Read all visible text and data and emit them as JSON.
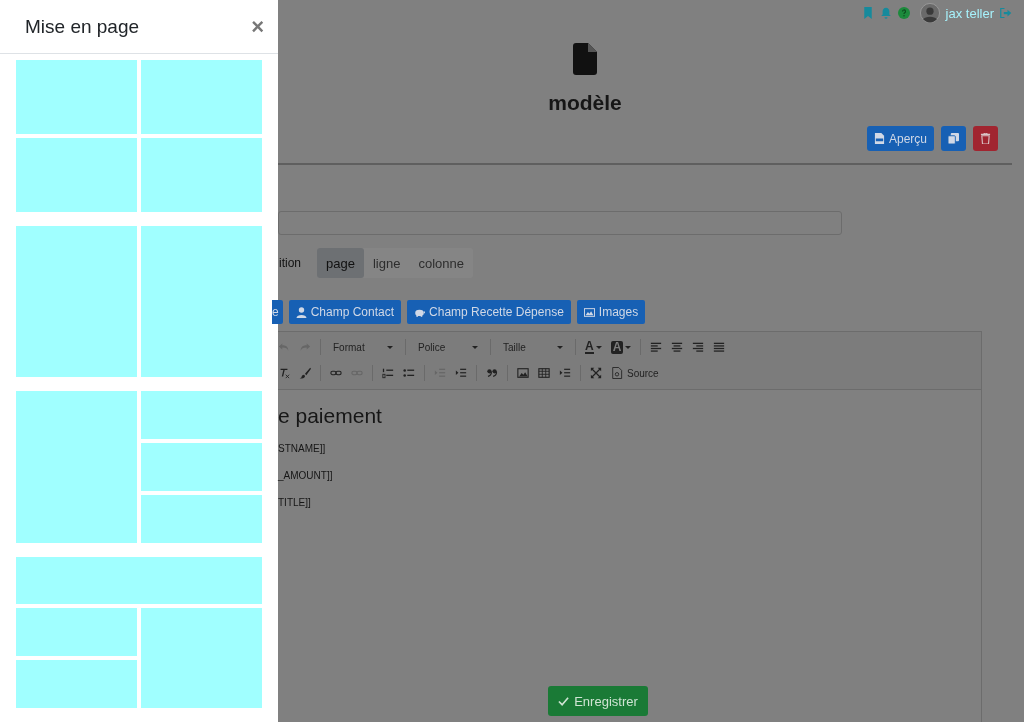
{
  "drawer": {
    "title": "Mise en page",
    "close": "×",
    "layouts": [
      {
        "kind": "grid-2x2"
      },
      {
        "kind": "two-columns"
      },
      {
        "kind": "left-tall-right-three"
      },
      {
        "kind": "header-left-two-right-tall"
      }
    ]
  },
  "header": {
    "user": "jax teller"
  },
  "page": {
    "title": "modèle",
    "actions": [
      {
        "kind": "preview",
        "label": "Aperçu",
        "color": "#1760b4"
      },
      {
        "kind": "copy",
        "color": "#1760b4"
      },
      {
        "kind": "delete",
        "color": "#a12530"
      }
    ],
    "position_label": "ition",
    "position_options": [
      {
        "label": "page",
        "selected": true
      },
      {
        "label": "ligne",
        "selected": false
      },
      {
        "label": "colonne",
        "selected": false
      }
    ],
    "field_buttons": [
      {
        "kind": "none",
        "label": "e"
      },
      {
        "kind": "person",
        "label": "Champ Contact"
      },
      {
        "kind": "piggy",
        "label": "Champ Recette Dépense"
      },
      {
        "kind": "image",
        "label": "Images"
      }
    ],
    "toolbar_rows": [
      [
        {
          "kind": "undo"
        },
        {
          "kind": "redo"
        },
        {
          "kind": "sep"
        },
        {
          "kind": "dropdown",
          "label": "Format"
        },
        {
          "kind": "sep"
        },
        {
          "kind": "dropdown",
          "label": "Police"
        },
        {
          "kind": "sep"
        },
        {
          "kind": "dropdown",
          "label": "Taille"
        },
        {
          "kind": "sep"
        },
        {
          "kind": "color",
          "label": "A"
        },
        {
          "kind": "bgcolor",
          "label": "A"
        },
        {
          "kind": "sep"
        },
        {
          "kind": "align-left"
        },
        {
          "kind": "align-center"
        },
        {
          "kind": "align-right"
        },
        {
          "kind": "align-justify"
        }
      ],
      [
        {
          "kind": "remove-format"
        },
        {
          "kind": "brush"
        },
        {
          "kind": "sep"
        },
        {
          "kind": "link"
        },
        {
          "kind": "unlink"
        },
        {
          "kind": "sep"
        },
        {
          "kind": "numbered-list"
        },
        {
          "kind": "bulleted-list"
        },
        {
          "kind": "sep"
        },
        {
          "kind": "outdent"
        },
        {
          "kind": "indent"
        },
        {
          "kind": "sep"
        },
        {
          "kind": "quote"
        },
        {
          "kind": "sep"
        },
        {
          "kind": "image"
        },
        {
          "kind": "table"
        },
        {
          "kind": "indent-block"
        },
        {
          "kind": "sep"
        },
        {
          "kind": "maximize"
        },
        {
          "kind": "source",
          "label": "Source"
        }
      ]
    ],
    "editor_heading": "e paiement",
    "editor_lines": [
      "STNAME]]",
      "_AMOUNT]]",
      "TITLE]]"
    ],
    "save": "Enregistrer"
  }
}
